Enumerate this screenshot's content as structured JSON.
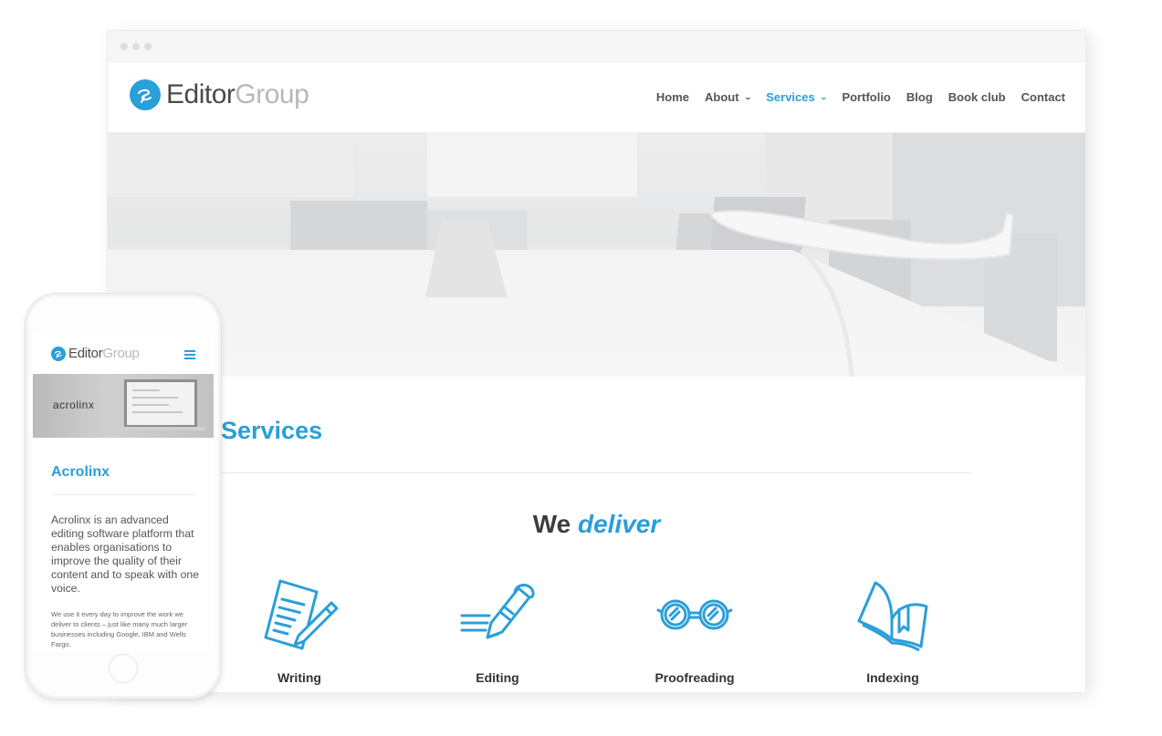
{
  "desktop": {
    "window_controls": [
      "dot",
      "dot",
      "dot"
    ],
    "header": {
      "logo": {
        "icon": "editor-group-logo-icon",
        "text_primary": "Editor",
        "text_secondary": "Group"
      },
      "nav": [
        {
          "label": "Home",
          "has_dropdown": false,
          "active": false
        },
        {
          "label": "About",
          "has_dropdown": true,
          "active": false
        },
        {
          "label": "Services",
          "has_dropdown": true,
          "active": true
        },
        {
          "label": "Portfolio",
          "has_dropdown": false,
          "active": false
        },
        {
          "label": "Blog",
          "has_dropdown": false,
          "active": false
        },
        {
          "label": "Book club",
          "has_dropdown": false,
          "active": false
        },
        {
          "label": "Contact",
          "has_dropdown": false,
          "active": false
        }
      ],
      "dropdown_glyph": "⌄"
    },
    "hero": {
      "image": "meeting-room-with-model-airplane"
    },
    "main": {
      "title": "Services",
      "tagline_plain": "We",
      "tagline_emph": "deliver",
      "services": [
        {
          "label": "Writing",
          "icon": "writing-document-pen-icon"
        },
        {
          "label": "Editing",
          "icon": "editing-pencil-icon"
        },
        {
          "label": "Proofreading",
          "icon": "proofreading-glasses-icon"
        },
        {
          "label": "Indexing",
          "icon": "indexing-book-icon"
        }
      ]
    }
  },
  "mobile": {
    "header": {
      "logo": {
        "text_primary": "Editor",
        "text_secondary": "Group"
      },
      "menu_icon": "hamburger-menu-icon"
    },
    "banner": {
      "brand_text": "acrolinx"
    },
    "title": "Acrolinx",
    "lead": "Acrolinx is an advanced editing software platform that enables organisations to improve the quality of their content and to speak with one voice.",
    "body": "We use it every day to improve the work we deliver to clients – just like many much larger businesses including Google, IBM and Wells Fargo."
  },
  "colors": {
    "accent": "#2a9fd8",
    "text_dark": "#3d3d3d",
    "nav_text": "#555555",
    "logo_grey": "#b8b8b8"
  }
}
